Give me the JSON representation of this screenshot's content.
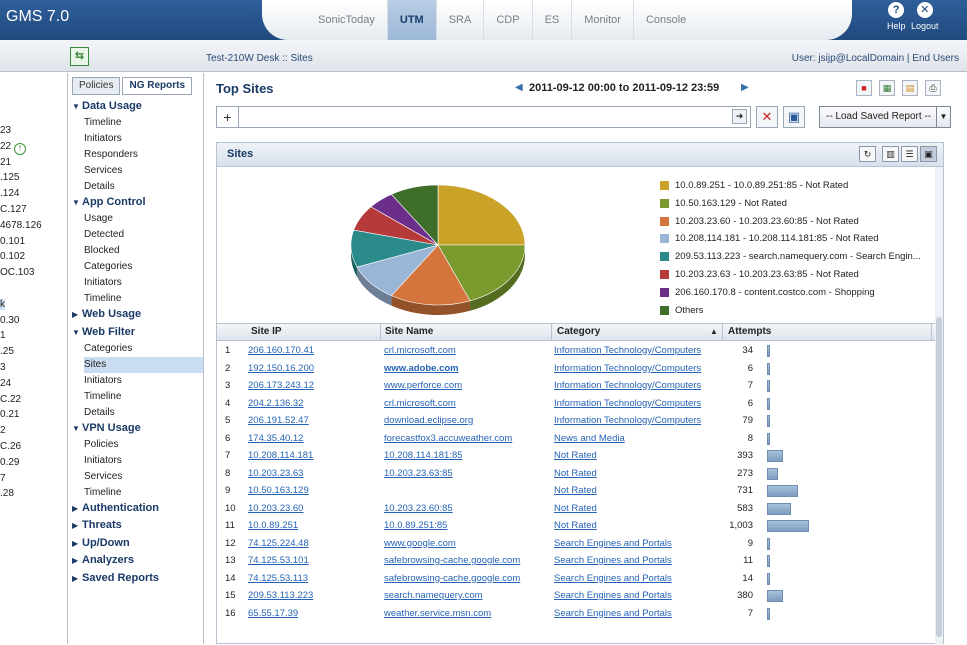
{
  "header": {
    "app_title": "GMS 7.0",
    "tabs": [
      "SonicToday",
      "UTM",
      "SRA",
      "CDP",
      "ES",
      "Monitor",
      "Console"
    ],
    "active_tab": "UTM",
    "help_label": "Help",
    "logout_label": "Logout"
  },
  "subheader": {
    "breadcrumb": "Test-210W Desk :: Sites",
    "user_info": "User: jsijp@LocalDomain | End Users"
  },
  "left_clip": {
    "items": [
      "23",
      "22",
      "21",
      ".125",
      ".124",
      "C.127",
      "4678.126",
      "0.101",
      "0.102",
      "OC.103",
      "",
      "k",
      "0.30",
      "1",
      ".25",
      "3",
      "24",
      "C.22",
      "0.21",
      "2",
      "C.26",
      "0.29",
      "7",
      ".28"
    ],
    "highlighted_index": 11
  },
  "nav": {
    "tabs": [
      "Policies",
      "NG Reports"
    ],
    "active_tab": "NG Reports",
    "sections": [
      {
        "label": "Data Usage",
        "expanded": true,
        "items": [
          "Timeline",
          "Initiators",
          "Responders",
          "Services",
          "Details"
        ]
      },
      {
        "label": "App Control",
        "expanded": true,
        "items": [
          "Usage",
          "Detected",
          "Blocked",
          "Categories",
          "Initiators",
          "Timeline"
        ]
      },
      {
        "label": "Web Usage",
        "expanded": false,
        "items": []
      },
      {
        "label": "Web Filter",
        "expanded": true,
        "items": [
          "Categories",
          "Sites",
          "Initiators",
          "Timeline",
          "Details"
        ]
      },
      {
        "label": "VPN Usage",
        "expanded": true,
        "items": [
          "Policies",
          "Initiators",
          "Services",
          "Timeline"
        ]
      },
      {
        "label": "Authentication",
        "expanded": false,
        "items": []
      },
      {
        "label": "Threats",
        "expanded": false,
        "items": []
      },
      {
        "label": "Up/Down",
        "expanded": false,
        "items": []
      },
      {
        "label": "Analyzers",
        "expanded": false,
        "items": []
      },
      {
        "label": "Saved Reports",
        "expanded": false,
        "items": []
      }
    ],
    "selected_item": "Sites"
  },
  "main": {
    "title": "Top Sites",
    "date_range": "2011-09-12 00:00 to 2011-09-12 23:59",
    "filter_value": "",
    "load_report_label": "-- Load Saved Report --",
    "panel_title": "Sites"
  },
  "chart_data": {
    "type": "pie",
    "legend_position": "right",
    "series": [
      {
        "name": "10.0.89.251 - 10.0.89.251:85 - Not Rated",
        "value": 25,
        "color": "#c9a227"
      },
      {
        "name": "10.50.163.129 - Not Rated",
        "value": 19,
        "color": "#7a9a2e"
      },
      {
        "name": "10.203.23.60 - 10.203.23.60:85 - Not Rated",
        "value": 15,
        "color": "#d3753c"
      },
      {
        "name": "10.208.114.181 - 10.208.114.181:85 - Not Rated",
        "value": 10,
        "color": "#9ab6d6"
      },
      {
        "name": "209.53.113.223 - search.namequery.com - Search Engin...",
        "value": 10,
        "color": "#2b8a8a"
      },
      {
        "name": "10.203.23.63 - 10.203.23.63:85 - Not Rated",
        "value": 7,
        "color": "#b63a3a"
      },
      {
        "name": "206.160.170.8 - content.costco.com - Shopping",
        "value": 5,
        "color": "#6b2f8a"
      },
      {
        "name": "Others",
        "value": 9,
        "color": "#3f6e2a"
      }
    ]
  },
  "table": {
    "columns": [
      "Site IP",
      "Site Name",
      "Category",
      "Attempts"
    ],
    "sort_column": "Category",
    "max_attempts": 1003,
    "rows": [
      {
        "n": "1",
        "ip": "206.160.170.41",
        "name": "crl.microsoft.com",
        "cat": "Information Technology/Computers",
        "att": "34",
        "attn": 34,
        "bold": false
      },
      {
        "n": "2",
        "ip": "192.150.16.200",
        "name": "www.adobe.com",
        "cat": "Information Technology/Computers",
        "att": "6",
        "attn": 6,
        "bold": true
      },
      {
        "n": "3",
        "ip": "206.173.243.12",
        "name": "www.perforce.com",
        "cat": "Information Technology/Computers",
        "att": "7",
        "attn": 7,
        "bold": false
      },
      {
        "n": "4",
        "ip": "204.2.136.32",
        "name": "crl.microsoft.com",
        "cat": "Information Technology/Computers",
        "att": "6",
        "attn": 6,
        "bold": false
      },
      {
        "n": "5",
        "ip": "206.191.52.47",
        "name": "download.eclipse.org",
        "cat": "Information Technology/Computers",
        "att": "79",
        "attn": 79,
        "bold": false
      },
      {
        "n": "6",
        "ip": "174.35.40.12",
        "name": "forecastfox3.accuweather.com",
        "cat": "News and Media",
        "att": "8",
        "attn": 8,
        "bold": false
      },
      {
        "n": "7",
        "ip": "10.208.114.181",
        "name": "10.208.114.181:85",
        "cat": "Not Rated",
        "att": "393",
        "attn": 393,
        "bold": false
      },
      {
        "n": "8",
        "ip": "10.203.23.63",
        "name": "10.203.23.63:85",
        "cat": "Not Rated",
        "att": "273",
        "attn": 273,
        "bold": false
      },
      {
        "n": "9",
        "ip": "10.50.163.129",
        "name": "",
        "cat": "Not Rated",
        "att": "731",
        "attn": 731,
        "bold": false
      },
      {
        "n": "10",
        "ip": "10.203.23.60",
        "name": "10.203.23.60:85",
        "cat": "Not Rated",
        "att": "583",
        "attn": 583,
        "bold": false
      },
      {
        "n": "11",
        "ip": "10.0.89.251",
        "name": "10.0.89.251:85",
        "cat": "Not Rated",
        "att": "1,003",
        "attn": 1003,
        "bold": false
      },
      {
        "n": "12",
        "ip": "74.125.224.48",
        "name": "www.google.com",
        "cat": "Search Engines and Portals",
        "att": "9",
        "attn": 9,
        "bold": false
      },
      {
        "n": "13",
        "ip": "74.125.53.101",
        "name": "safebrowsing-cache.google.com",
        "cat": "Search Engines and Portals",
        "att": "11",
        "attn": 11,
        "bold": false
      },
      {
        "n": "14",
        "ip": "74.125.53.113",
        "name": "safebrowsing-cache.google.com",
        "cat": "Search Engines and Portals",
        "att": "14",
        "attn": 14,
        "bold": false
      },
      {
        "n": "15",
        "ip": "209.53.113.223",
        "name": "search.namequery.com",
        "cat": "Search Engines and Portals",
        "att": "380",
        "attn": 380,
        "bold": false
      },
      {
        "n": "16",
        "ip": "65.55.17.39",
        "name": "weather.service.msn.com",
        "cat": "Search Engines and Portals",
        "att": "7",
        "attn": 7,
        "bold": false
      }
    ]
  }
}
